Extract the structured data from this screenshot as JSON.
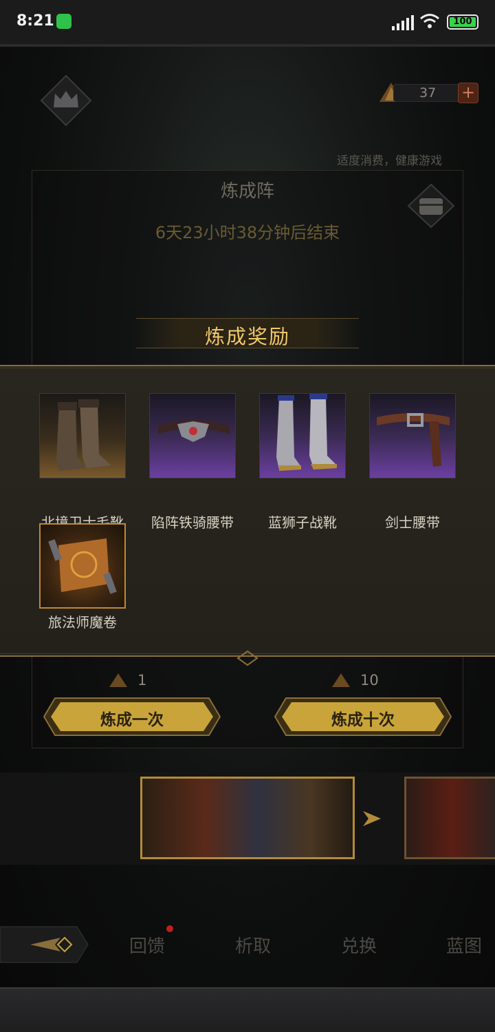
{
  "status_bar": {
    "time": "8:21",
    "battery": "100"
  },
  "header": {
    "currency_value": "37",
    "plus_label": "+",
    "notice": "适度消费，健康游戏"
  },
  "main": {
    "title": "炼成阵",
    "countdown": "6天23小时38分钟后结束",
    "reward_title": "炼成奖励"
  },
  "rewards": [
    {
      "name": "北境卫士毛靴",
      "rarity": "gold"
    },
    {
      "name": "陷阵铁骑腰带",
      "rarity": "purple"
    },
    {
      "name": "蓝狮子战靴",
      "rarity": "purple"
    },
    {
      "name": "剑士腰带",
      "rarity": "purple"
    },
    {
      "name": "旅法师魔卷",
      "rarity": "orange"
    }
  ],
  "refine": {
    "once": {
      "cost": "1",
      "label": "炼成一次"
    },
    "ten": {
      "cost": "10",
      "label": "炼成十次"
    }
  },
  "nav": {
    "tabs": [
      "回馈",
      "析取",
      "兑换",
      "蓝图"
    ]
  },
  "colors": {
    "gold_text": "#f0c86a",
    "panel_border": "#8a6f3a",
    "button_gold": "#c9a43a",
    "rarity_purple": "#6b3fa0",
    "rarity_gold": "#7a5a2c",
    "red_dot": "#c0201a"
  }
}
